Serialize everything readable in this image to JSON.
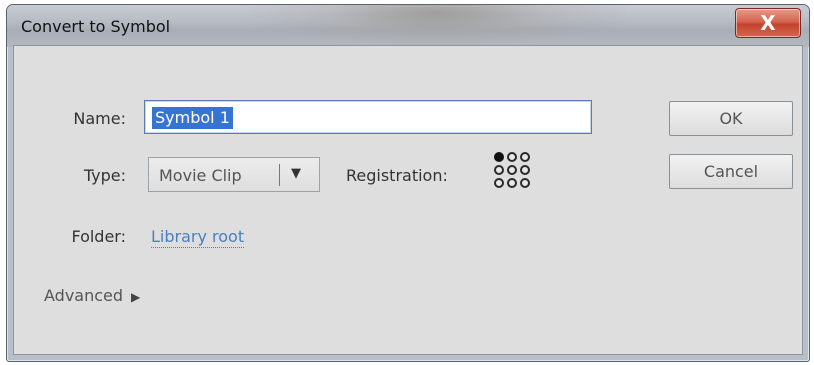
{
  "dialog": {
    "title": "Convert to Symbol",
    "close_glyph": "X"
  },
  "form": {
    "name_label": "Name:",
    "name_value": "Symbol 1",
    "type_label": "Type:",
    "type_value": "Movie Clip",
    "registration_label": "Registration:",
    "registration_active": "top-left",
    "folder_label": "Folder:",
    "folder_value": "Library root",
    "advanced_label": "Advanced"
  },
  "buttons": {
    "ok": "OK",
    "cancel": "Cancel"
  },
  "icons": {
    "close": "close-icon",
    "dropdown": "dropdown-arrow-icon",
    "expand": "expand-arrow-icon",
    "registration": "registration-grid-icon"
  },
  "colors": {
    "selection": "#3574d2",
    "link": "#4a7fc0",
    "close_button": "#c2432e"
  }
}
